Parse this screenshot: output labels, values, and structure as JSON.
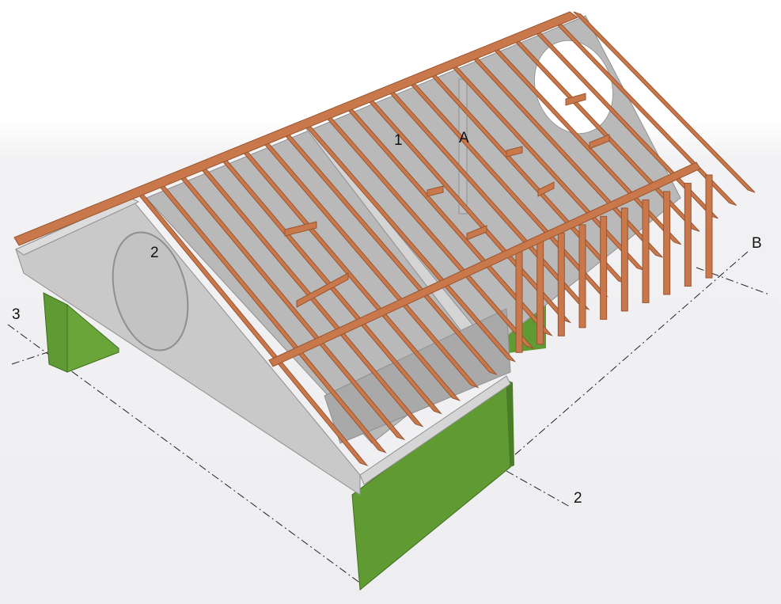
{
  "labels": {
    "grid_3": "3",
    "grid_b": "B",
    "grid_2": "2",
    "marker_1": "1",
    "marker_a": "A",
    "marker_2": "2"
  },
  "colors": {
    "timber": "#c8784a",
    "timber_dark": "#9a5530",
    "concrete": "#c9c9c9",
    "concrete_dark": "#8f8f8f",
    "wall_green": "#5f9a33",
    "wall_green_dark": "#3f6e1f",
    "gridline": "#222222"
  },
  "icons": [
    "roof-truss-model"
  ]
}
